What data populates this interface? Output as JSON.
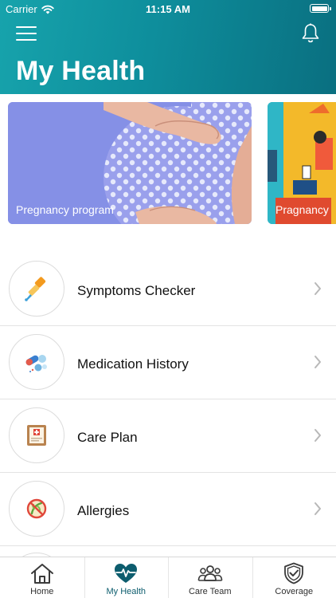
{
  "status_bar": {
    "carrier": "Carrier",
    "time": "11:15 AM"
  },
  "header": {
    "title": "My Health",
    "menu_icon": "hamburger-icon",
    "notification_icon": "bell-icon"
  },
  "programs": [
    {
      "label": "Pregnancy program"
    },
    {
      "label": "Pragnancy"
    }
  ],
  "health_items": [
    {
      "label": "Symptoms Checker",
      "icon": "dropper-icon"
    },
    {
      "label": "Medication History",
      "icon": "pills-icon"
    },
    {
      "label": "Care Plan",
      "icon": "medical-chart-icon"
    },
    {
      "label": "Allergies",
      "icon": "allergy-icon"
    }
  ],
  "tabbar": {
    "tabs": [
      {
        "label": "Home",
        "icon": "home-icon"
      },
      {
        "label": "My Health",
        "icon": "heart-pulse-icon",
        "active": true
      },
      {
        "label": "Care Team",
        "icon": "group-icon"
      },
      {
        "label": "Coverage",
        "icon": "shield-check-icon"
      }
    ]
  },
  "colors": {
    "header_start": "#17a3ac",
    "header_end": "#0a6f80",
    "active_tab": "#0d5d6e"
  }
}
